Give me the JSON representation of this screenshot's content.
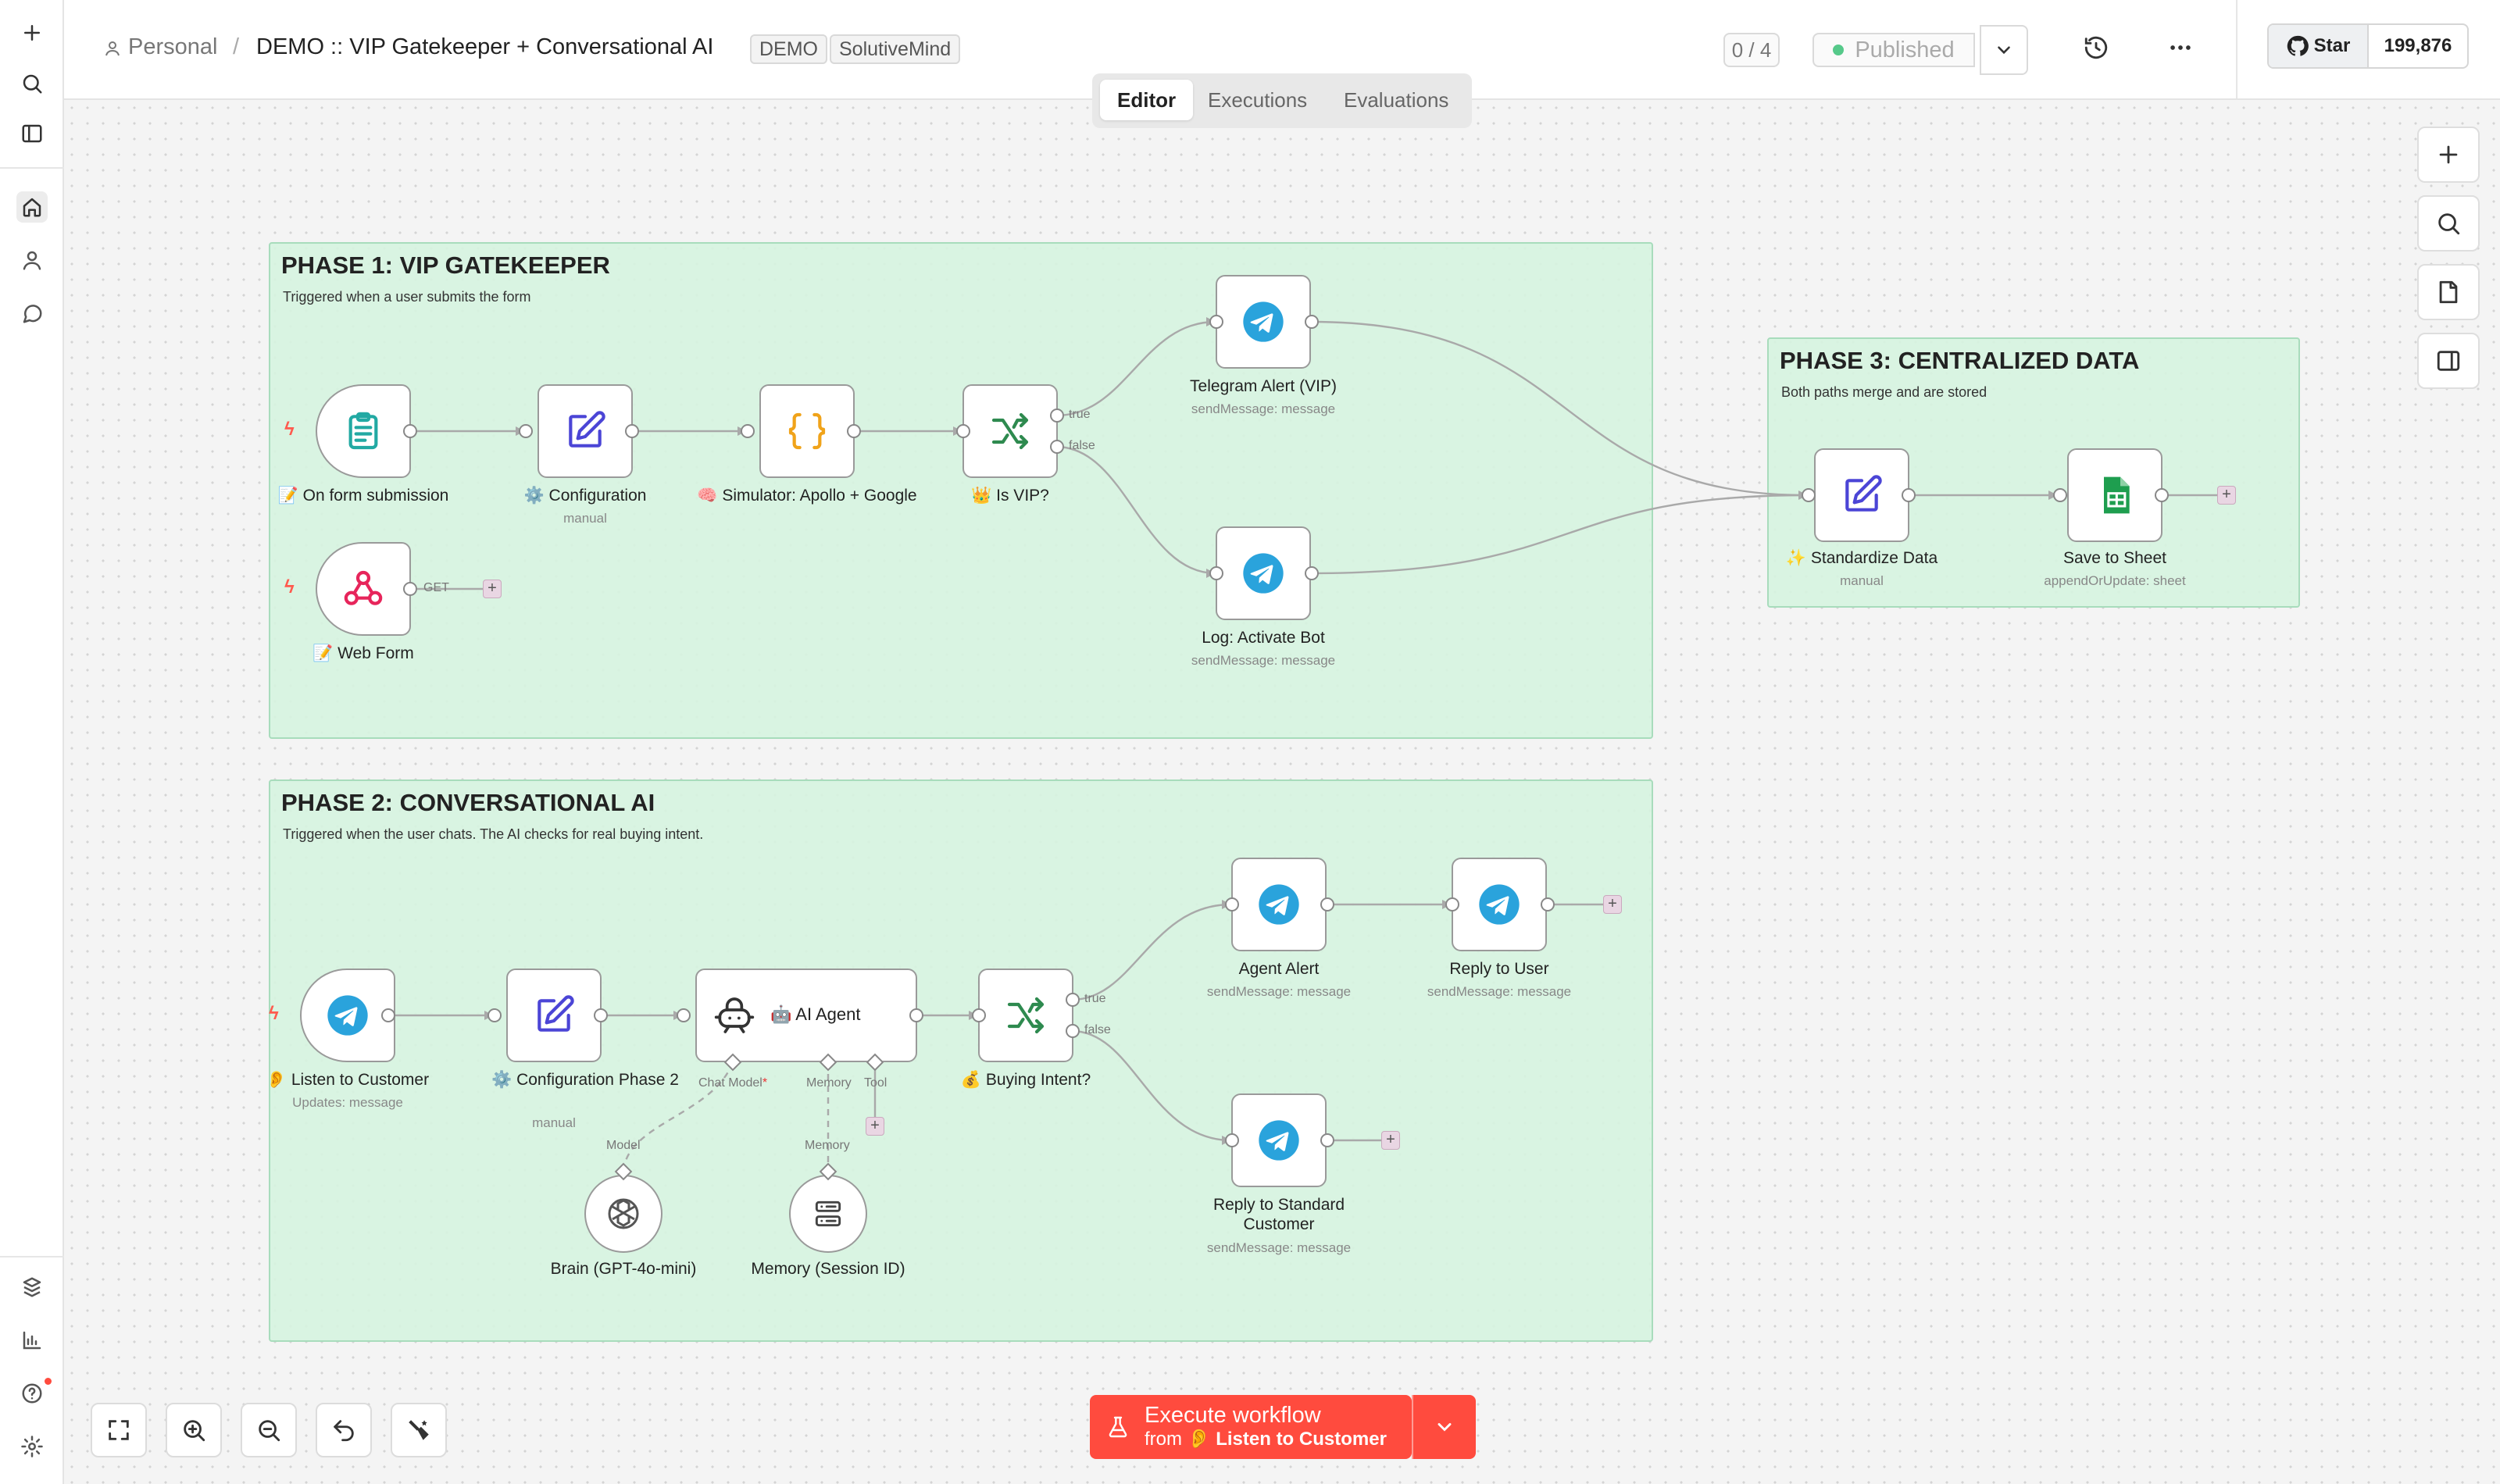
{
  "header": {
    "breadcrumb_project": "Personal",
    "separator": "/",
    "title": "DEMO :: VIP Gatekeeper + Conversational AI",
    "tags": [
      "DEMO",
      "SolutiveMind"
    ],
    "progress": "0 / 4",
    "publish_label": "Published",
    "star_label": "Star",
    "star_count": "199,876"
  },
  "tabs": [
    "Editor",
    "Executions",
    "Evaluations"
  ],
  "phases": [
    {
      "title": "PHASE 1: VIP GATEKEEPER",
      "subtitle": "Triggered when a user submits the form"
    },
    {
      "title": "PHASE 2: CONVERSATIONAL AI",
      "subtitle": "Triggered when the user chats. The AI checks for real buying intent."
    },
    {
      "title": "PHASE 3: CENTRALIZED DATA",
      "subtitle": "Both paths merge and are stored"
    }
  ],
  "nodes": {
    "form_submission": {
      "label": "📝 On form submission"
    },
    "configuration": {
      "label": "⚙️ Configuration",
      "sub": "manual"
    },
    "simulator": {
      "label": "🧠 Simulator: Apollo + Google"
    },
    "is_vip": {
      "label": "👑 Is VIP?"
    },
    "telegram_vip": {
      "label": "Telegram Alert (VIP)",
      "sub": "sendMessage: message"
    },
    "log_activate": {
      "label": "Log: Activate Bot",
      "sub": "sendMessage: message"
    },
    "web_form": {
      "label": "📝 Web Form",
      "edge": "GET"
    },
    "standardize": {
      "label": "✨ Standardize Data",
      "sub": "manual"
    },
    "save_sheet": {
      "label": "Save to Sheet",
      "sub": "appendOrUpdate: sheet"
    },
    "listen_customer": {
      "label": "👂 Listen to Customer",
      "sub": "Updates: message"
    },
    "config_phase2": {
      "label": "⚙️ Configuration Phase 2",
      "sub": "manual"
    },
    "ai_agent": {
      "label": "🤖 AI Agent",
      "ports": [
        "Chat Model",
        "Memory",
        "Tool"
      ]
    },
    "buying_intent": {
      "label": "💰 Buying Intent?"
    },
    "agent_alert": {
      "label": "Agent Alert",
      "sub": "sendMessage: message"
    },
    "reply_user": {
      "label": "Reply to User",
      "sub": "sendMessage: message"
    },
    "reply_standard": {
      "label": "Reply to Standard Customer",
      "sub": "sendMessage: message"
    },
    "brain": {
      "label": "Brain (GPT-4o-mini)",
      "port": "Model"
    },
    "memory": {
      "label": "Memory (Session ID)",
      "port": "Memory"
    }
  },
  "edge_labels": {
    "true": "true",
    "false": "false"
  },
  "execute": {
    "title": "Execute workflow",
    "from": "from",
    "target": "👂 Listen to Customer"
  },
  "colors": {
    "telegram": "#2aa3dc",
    "configuration": "#4b45d6",
    "simulator": "#f0a31a",
    "switch": "#2e8a4f",
    "webhook": "#e7255b",
    "sheets": "#1e9e4f",
    "execute": "#ff4b3e",
    "phase_bg": "#d6f3e0"
  }
}
